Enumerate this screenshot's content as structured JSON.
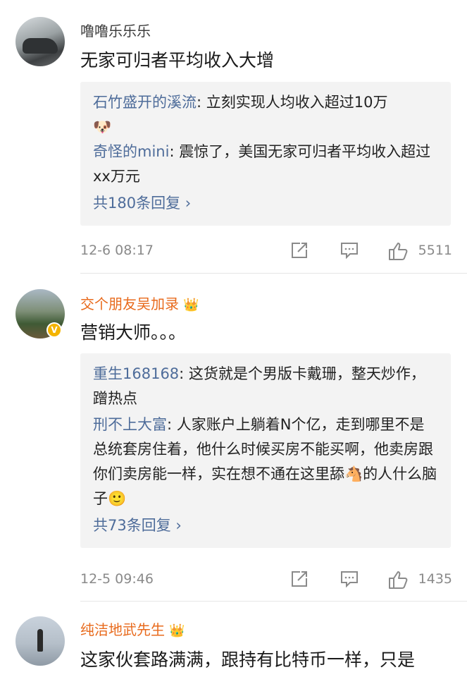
{
  "comments": [
    {
      "username": "噜噜乐乐乐",
      "text": "无家可归者平均收入大增",
      "replies": [
        {
          "name": "石竹盛开的溪流",
          "text": ": 立刻实现人均收入超过10万",
          "emoji": "🐶"
        },
        {
          "name": "奇怪的mini",
          "text": ": 震惊了，美国无家可归者平均收入超过xx万元"
        }
      ],
      "reply_more": "共180条回复 ›",
      "date": "12-6 08:17",
      "likes": "5511"
    },
    {
      "username": "交个朋友吴加录",
      "username_badge": "👑",
      "verified": "V",
      "text": "营销大师。。。",
      "replies": [
        {
          "name": "重生168168",
          "text": ": 这货就是个男版卡戴珊，整天炒作，蹭热点"
        },
        {
          "name": "刑不上大富",
          "text": ": 人家账户上躺着N个亿，走到哪里不是总统套房住着，他什么时候买房不能买啊，他卖房跟你们卖房能一样，实在想不通在这里舔",
          "emoji": "🐴",
          "text2": "的人什么脑子",
          "emoji2": "🙂"
        }
      ],
      "reply_more": "共73条回复 ›",
      "date": "12-5 09:46",
      "likes": "1435"
    },
    {
      "username": "纯洁地武先生",
      "username_badge": "👑",
      "text": "这家伙套路满满，跟持有比特币一样，只是"
    }
  ]
}
